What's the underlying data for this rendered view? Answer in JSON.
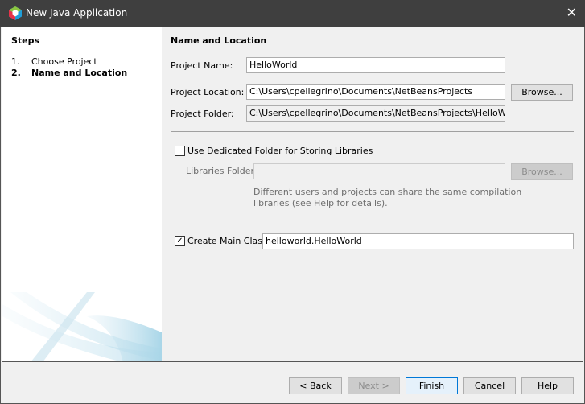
{
  "window": {
    "title": "New Java Application",
    "close_icon": "close-icon",
    "app_icon": "netbeans-cube-icon"
  },
  "steps": {
    "header": "Steps",
    "items": [
      {
        "num": "1.",
        "label": "Choose Project",
        "current": false
      },
      {
        "num": "2.",
        "label": "Name and Location",
        "current": true
      }
    ]
  },
  "main": {
    "header": "Name and Location",
    "project_name": {
      "label": "Project Name:",
      "value": "HelloWorld"
    },
    "project_location": {
      "label": "Project Location:",
      "value": "C:\\Users\\cpellegrino\\Documents\\NetBeansProjects",
      "browse": "Browse..."
    },
    "project_folder": {
      "label": "Project Folder:",
      "value": "C:\\Users\\cpellegrino\\Documents\\NetBeansProjects\\HelloWorld"
    },
    "dedicated_folder": {
      "label": "Use Dedicated Folder for Storing Libraries",
      "checked": false
    },
    "libraries_folder": {
      "label": "Libraries Folder:",
      "value": "",
      "browse": "Browse..."
    },
    "help_text": [
      "Different users and projects can share the same compilation",
      "libraries (see Help for details)."
    ],
    "main_class": {
      "label": "Create Main Class",
      "checked": true,
      "value": "helloworld.HelloWorld"
    }
  },
  "buttons": {
    "back": "< Back",
    "next": "Next >",
    "finish": "Finish",
    "cancel": "Cancel",
    "help": "Help"
  }
}
